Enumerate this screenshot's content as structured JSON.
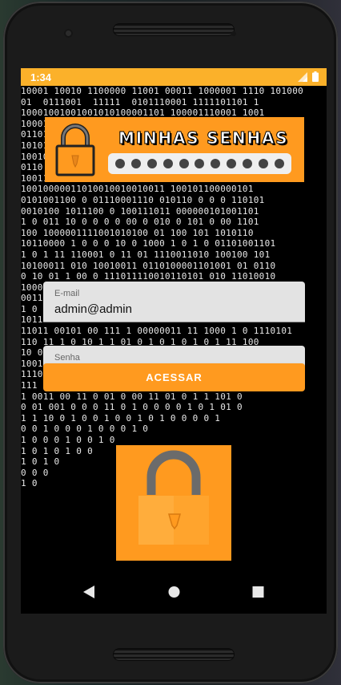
{
  "status_bar": {
    "time": "1:34"
  },
  "background": {
    "lines": [
      "10001 10010 1100000 11001 00011 1000001 1110 101000",
      "01  0111001  11111  0101110001 1111101101 1",
      "10001001001001010100001101 100001110001 1001",
      "10001110001001001000010001001 01 000110010 110000",
      "01101100101010111 101110010 0 010101010",
      "10101110 01 1111011001101 000101 01111001",
      "10010011 1111101100001110001101100000011 0 1",
      "0110 1100100 110000110 1110 1101000111 1001011",
      "10011001 01000111001 11011 0 00110010111 01",
      "10010000011010010010010011 100101100000101",
      "0101001100 0 01110001110 010110 0 0 0 110101",
      "0010100 1011100 0 100111011 000000101001101",
      "1 0 011 10 0 0 0 0 00 0 010 0 101 0 00 1101",
      "100 1000001111001010100 01 100 101 1010110",
      "10110000 1 0 0 0 10 0 1000 1 0 1 0 01101001101",
      "1 0 1 11 110001 0 11 01 1110011010 100100 101",
      "10100011 010 10010011 0110100001101001 01 0110",
      "0 10 01 1 00 0 111011110010110101 010 11010010",
      "10001011 1011 100 11 0 1011010011001 001 100010",
      "0011110 0010101 000 1 01 10 01 1110 0 0 1100101",
      "1 0 11 00 1 1 0 1 0 0 1 1 011 0 0 00110111011",
      "101101001011111001 1101 0 0 10 1101011100110",
      "11011 00101 00 111 1 00000011 11 1000 1 0 1110101",
      "110 11 1 0 10 1 1 01 0 1 0 1 0 1 0 1 11 100",
      "10 011 0 0 1 0 1 1001110 1010100010 110 0110110",
      "1001011 11010 010 110001 11 011 10010 1010001",
      "11101 01100 0010101 100 01 0 1 1 00101100110",
      "111 1 0 1 0 001 1 0 0 0 1 1 10 0 111 0 11",
      "1 0011 00 11 0 01 0 00 11 01 0 1 1 101 0",
      "0 01 001 0 0 0 11 0 1 0 0 0 0 1 0 1 01 0",
      "1 1 10 0 1 0 0 1 0 0 1 0 1 0 0 0 0 1",
      "0 0 1 0 0 0 1 0 0 0 1 0",
      "1 0 0 0 1 0 0 1 0",
      "1 0 1 0 1 0 0",
      "1 0 1 0",
      "0 0 0",
      "1 0"
    ]
  },
  "banner": {
    "title": "MINHAS SENHAS",
    "dots": [
      "•",
      "•",
      "•",
      "•",
      "•",
      "•",
      "•",
      "•",
      "•",
      "•",
      "•"
    ]
  },
  "email_field": {
    "label": "E-mail",
    "value": "admin@admin"
  },
  "password_field": {
    "label": "Senha",
    "value": "••••••"
  },
  "login_button": {
    "label": "ACESSAR"
  },
  "colors": {
    "accent": "#ff9a1f",
    "status_bar": "#fbb12a",
    "field_bg": "#e3e3e3"
  },
  "nav": {
    "back": "back-icon",
    "home": "home-icon",
    "recents": "recents-icon"
  }
}
